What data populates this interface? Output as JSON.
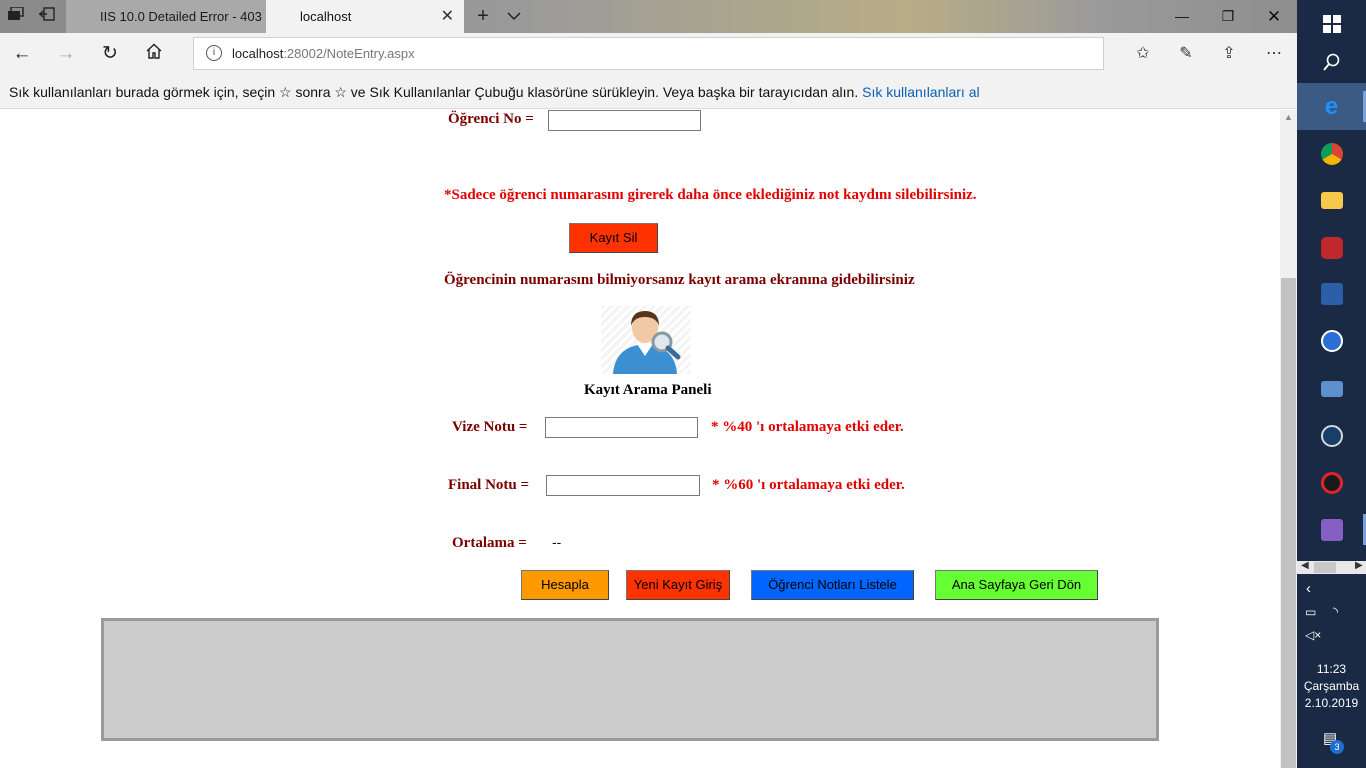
{
  "browser": {
    "tabs": [
      {
        "title": "IIS 10.0 Detailed Error - 403"
      },
      {
        "title": "localhost"
      }
    ],
    "address": {
      "host": "localhost",
      "rest": ":28002/NoteEntry.aspx"
    },
    "favorites_bar": {
      "message": "Sık kullanılanları burada görmek için, seçin  ☆  sonra ☆ ve Sık Kullanılanlar Çubuğu klasörüne sürükleyin. Veya başka bir tarayıcıdan alın.",
      "link": "Sık kullanılanları al"
    }
  },
  "page": {
    "student_no_label": "Öğrenci No =",
    "delete_notice": "*Sadece öğrenci numarasını girerek daha önce eklediğiniz not kaydını silebilirsiniz.",
    "delete_button": "Kayıt Sil",
    "search_hint": "Öğrencinin numarasını bilmiyorsanız kayıt arama ekranına gidebilirsiniz",
    "search_panel_label": "Kayıt Arama Paneli",
    "midterm_label": "Vize Notu =",
    "midterm_note": "* %40 'ı ortalamaya etki eder.",
    "final_label": "Final Notu =",
    "final_note": "* %60 'ı ortalamaya etki eder.",
    "average_label": "Ortalama =",
    "average_value": "--",
    "buttons": {
      "calculate": "Hesapla",
      "new_entry": "Yeni Kayıt Giriş",
      "list_grades": "Öğrenci Notları Listele",
      "back_home": "Ana Sayfaya Geri Dön"
    },
    "colors": {
      "label": "#7a0000",
      "warning": "#e40000",
      "calculate_btn": "#ff9900",
      "new_entry_btn": "#ff3300",
      "delete_btn": "#ff3300",
      "list_btn": "#0066ff",
      "home_btn": "#66ff33"
    }
  },
  "taskbar": {
    "clock": {
      "time": "11:23",
      "day": "Çarşamba",
      "date": "2.10.2019"
    },
    "notification_count": "3"
  }
}
